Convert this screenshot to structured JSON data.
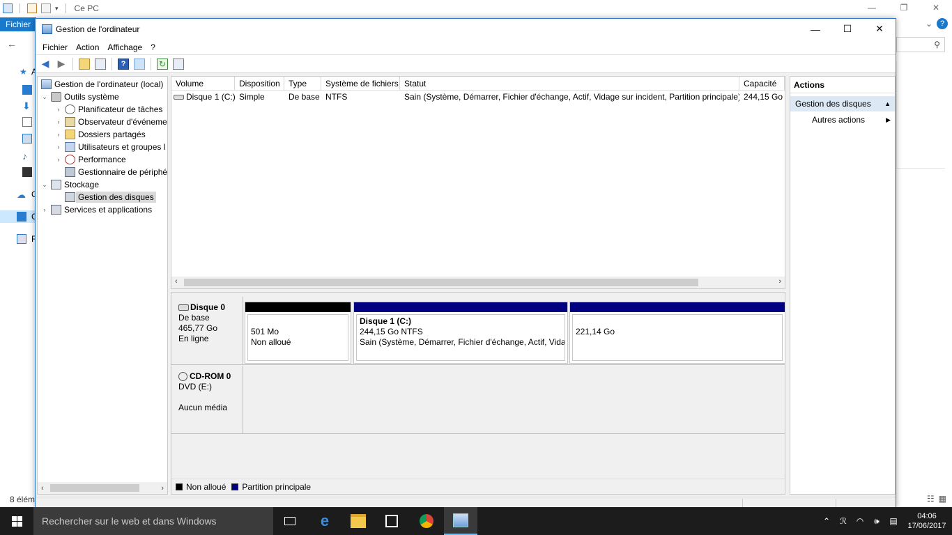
{
  "explorer": {
    "title": "Ce PC",
    "file_tab": "Fichier",
    "nav_letters": [
      "A",
      "",
      "",
      "",
      "",
      "",
      "C",
      "C",
      "R"
    ],
    "status_count": "8 élém"
  },
  "window": {
    "title": "Gestion de l'ordinateur",
    "controls": {
      "minimize": "—",
      "maximize": "☐",
      "close": "✕"
    }
  },
  "menu": [
    "Fichier",
    "Action",
    "Affichage",
    "?"
  ],
  "tree": [
    {
      "label": "Gestion de l'ordinateur (local)",
      "level": 0,
      "arrow": "",
      "icon": "computer-icon"
    },
    {
      "label": "Outils système",
      "level": 1,
      "arrow": "⌄",
      "icon": "tools-icon"
    },
    {
      "label": "Planificateur de tâches",
      "level": 2,
      "arrow": "›",
      "icon": "clock-icon"
    },
    {
      "label": "Observateur d'événeme",
      "level": 2,
      "arrow": "›",
      "icon": "event-viewer-icon"
    },
    {
      "label": "Dossiers partagés",
      "level": 2,
      "arrow": "›",
      "icon": "shared-folder-icon"
    },
    {
      "label": "Utilisateurs et groupes l",
      "level": 2,
      "arrow": "›",
      "icon": "users-icon"
    },
    {
      "label": "Performance",
      "level": 2,
      "arrow": "›",
      "icon": "performance-icon"
    },
    {
      "label": "Gestionnaire de périphé",
      "level": 2,
      "arrow": "",
      "icon": "device-manager-icon"
    },
    {
      "label": "Stockage",
      "level": 1,
      "arrow": "⌄",
      "icon": "storage-icon"
    },
    {
      "label": "Gestion des disques",
      "level": 2,
      "arrow": "",
      "icon": "disk-management-icon",
      "selected": true
    },
    {
      "label": "Services et applications",
      "level": 1,
      "arrow": "›",
      "icon": "services-icon"
    }
  ],
  "volumes": {
    "columns": [
      "Volume",
      "Disposition",
      "Type",
      "Système de fichiers",
      "Statut",
      "Capacité"
    ],
    "rows": [
      [
        "Disque 1 (C:)",
        "Simple",
        "De base",
        "NTFS",
        "Sain (Système, Démarrer, Fichier d'échange, Actif, Vidage sur incident, Partition principale)",
        "244,15 Go"
      ]
    ]
  },
  "disks": {
    "disk0": {
      "name": "Disque 0",
      "type": "De base",
      "size": "465,77 Go",
      "state": "En ligne",
      "partitions": [
        {
          "line1": "501 Mo",
          "line2": "Non alloué",
          "line3": "",
          "bar_color": "#000000",
          "title": ""
        },
        {
          "title": "Disque 1  (C:)",
          "line1": "244,15 Go NTFS",
          "line2": "Sain (Système, Démarrer, Fichier d'échange, Actif, Vidag",
          "bar_color": "#000080"
        },
        {
          "title": "",
          "line1": "221,14 Go",
          "line2": "",
          "bar_color": "#000080"
        }
      ]
    },
    "cdrom": {
      "name": "CD-ROM 0",
      "type": "DVD (E:)",
      "media": "Aucun média"
    }
  },
  "legend": [
    {
      "label": "Non alloué",
      "color": "#000000"
    },
    {
      "label": "Partition principale",
      "color": "#000080"
    }
  ],
  "actions": {
    "header": "Actions",
    "group": "Gestion des disques",
    "group_arrow": "▲",
    "items": [
      {
        "label": "Autres actions",
        "arrow": "▶"
      }
    ]
  },
  "taskbar": {
    "search_placeholder": "Rechercher sur le web et dans Windows",
    "time": "04:06",
    "date": "17/06/2017"
  }
}
